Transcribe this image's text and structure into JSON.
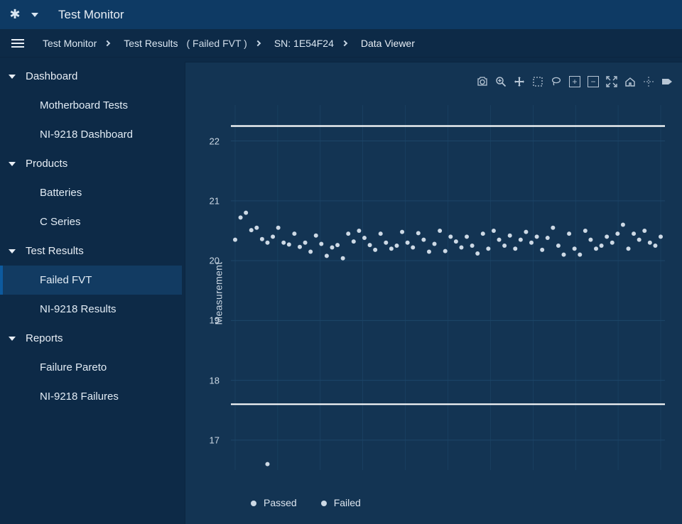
{
  "titlebar": {
    "app_title": "Test Monitor"
  },
  "breadcrumbs": {
    "items": [
      {
        "label": "Test Monitor"
      },
      {
        "label": "Test Results",
        "filter": "( Failed FVT )"
      },
      {
        "label": "SN: 1E54F24"
      },
      {
        "label": "Data Viewer"
      }
    ]
  },
  "sidebar": {
    "groups": [
      {
        "label": "Dashboard",
        "items": [
          {
            "label": "Motherboard Tests",
            "active": false
          },
          {
            "label": "NI-9218 Dashboard",
            "active": false
          }
        ]
      },
      {
        "label": "Products",
        "items": [
          {
            "label": "Batteries",
            "active": false
          },
          {
            "label": "C Series",
            "active": false
          }
        ]
      },
      {
        "label": "Test Results",
        "items": [
          {
            "label": "Failed FVT",
            "active": true
          },
          {
            "label": "NI-9218 Results",
            "active": false
          }
        ]
      },
      {
        "label": "Reports",
        "items": [
          {
            "label": "Failure Pareto",
            "active": false
          },
          {
            "label": "NI-9218 Failures",
            "active": false
          }
        ]
      }
    ]
  },
  "chart": {
    "ylabel": "Measurement",
    "yticks": [
      "22",
      "21",
      "20",
      "19",
      "18",
      "17"
    ],
    "legend": [
      {
        "name": "Passed"
      },
      {
        "name": "Failed"
      }
    ]
  },
  "toolbar_icons": {
    "camera": "camera-icon",
    "zoom": "zoom-icon",
    "pan": "pan-icon",
    "box": "box-select-icon",
    "lasso": "lasso-icon",
    "plus": "plus-icon",
    "minus": "minus-icon",
    "autoscale": "autoscale-icon",
    "home": "home-icon",
    "spike": "spikeline-icon",
    "tag": "tag-icon"
  },
  "chart_data": {
    "type": "scatter",
    "ylabel": "Measurement",
    "xlabel": "",
    "ylim": [
      16.5,
      22.6
    ],
    "upper_limit": 22.25,
    "lower_limit": 17.6,
    "series": [
      {
        "name": "Passed",
        "x_index": [
          0,
          1,
          2,
          3,
          4,
          5,
          6,
          7,
          8,
          9,
          10,
          11,
          12,
          13,
          14,
          15,
          16,
          17,
          18,
          19,
          20,
          21,
          22,
          23,
          24,
          25,
          26,
          27,
          28,
          29,
          30,
          31,
          32,
          33,
          34,
          35,
          36,
          37,
          38,
          39,
          40,
          41,
          42,
          43,
          44,
          45,
          46,
          47,
          48,
          49,
          50,
          51,
          52,
          53,
          54,
          55,
          56,
          57,
          58,
          59,
          60,
          61,
          62,
          63,
          64,
          65,
          66,
          67,
          68,
          69,
          70,
          71,
          72,
          73,
          74,
          75,
          76,
          77,
          78,
          79
        ],
        "values": [
          20.35,
          20.72,
          20.8,
          20.51,
          20.55,
          20.36,
          20.3,
          20.4,
          20.55,
          20.3,
          20.27,
          20.45,
          20.23,
          20.3,
          20.15,
          20.42,
          20.28,
          20.08,
          20.22,
          20.26,
          20.04,
          20.45,
          20.32,
          20.5,
          20.38,
          20.26,
          20.18,
          20.45,
          20.3,
          20.2,
          20.25,
          20.48,
          20.3,
          20.22,
          20.46,
          20.35,
          20.15,
          20.28,
          20.5,
          20.16,
          20.4,
          20.32,
          20.22,
          20.4,
          20.25,
          20.12,
          20.45,
          20.2,
          20.5,
          20.35,
          20.25,
          20.42,
          20.2,
          20.35,
          20.48,
          20.3,
          20.4,
          20.18,
          20.38,
          20.55,
          20.25,
          20.1,
          20.45,
          20.2,
          20.1,
          20.5,
          20.35,
          20.2,
          20.25,
          20.4,
          20.3,
          20.45,
          20.6,
          20.2,
          20.45,
          20.35,
          20.5,
          20.3,
          20.25,
          20.4
        ]
      },
      {
        "name": "Failed",
        "x_index": [
          6
        ],
        "values": [
          16.6
        ]
      }
    ]
  }
}
